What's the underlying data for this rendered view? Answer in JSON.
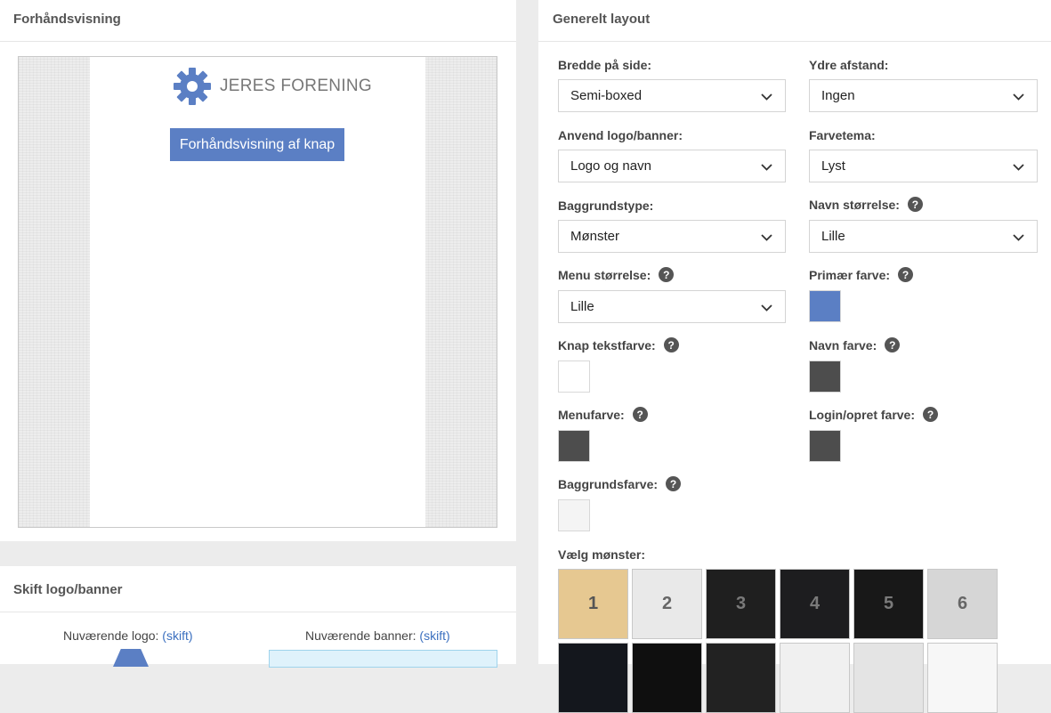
{
  "preview": {
    "title": "Forhåndsvisning",
    "org_name": "JERES FORENING",
    "button_label": "Forhåndsvisning af knap"
  },
  "change_logo": {
    "title": "Skift logo/banner",
    "current_logo_label": "Nuværende logo:",
    "current_banner_label": "Nuværende banner:",
    "change_link": "(skift)"
  },
  "layout": {
    "title": "Generelt layout",
    "page_width": {
      "label": "Bredde på side:",
      "value": "Semi-boxed"
    },
    "outer_spacing": {
      "label": "Ydre afstand:",
      "value": "Ingen"
    },
    "use_logo": {
      "label": "Anvend logo/banner:",
      "value": "Logo og navn"
    },
    "color_theme": {
      "label": "Farvetema:",
      "value": "Lyst"
    },
    "background_type": {
      "label": "Baggrundstype:",
      "value": "Mønster"
    },
    "name_size": {
      "label": "Navn størrelse:",
      "value": "Lille"
    },
    "menu_size": {
      "label": "Menu størrelse:",
      "value": "Lille"
    },
    "primary_color": {
      "label": "Primær farve:",
      "color": "#5b7fc4"
    },
    "button_text_color": {
      "label": "Knap tekstfarve:",
      "color": "#ffffff"
    },
    "name_color": {
      "label": "Navn farve:",
      "color": "#4d4d4d"
    },
    "menu_color": {
      "label": "Menufarve:",
      "color": "#4d4d4d"
    },
    "login_color": {
      "label": "Login/opret farve:",
      "color": "#4d4d4d"
    },
    "background_color": {
      "label": "Baggrundsfarve:",
      "color": "#f4f4f4"
    },
    "help_glyph": "?",
    "pattern_label": "Vælg mønster:",
    "patterns": [
      {
        "label": "1",
        "bg": "#e6c891",
        "fg": "#555555"
      },
      {
        "label": "2",
        "bg": "#e9e9e9",
        "fg": "#666666"
      },
      {
        "label": "3",
        "bg": "#1f1f1f",
        "fg": "#7a7a7a"
      },
      {
        "label": "4",
        "bg": "#1d1d1f",
        "fg": "#7a7a7a"
      },
      {
        "label": "5",
        "bg": "#181818",
        "fg": "#7a7a7a"
      },
      {
        "label": "6",
        "bg": "#d6d6d6",
        "fg": "#666666"
      },
      {
        "label": "",
        "bg": "#14171d",
        "fg": "#7a7a7a"
      },
      {
        "label": "",
        "bg": "#0f0f0f",
        "fg": "#7a7a7a"
      },
      {
        "label": "",
        "bg": "#222222",
        "fg": "#7a7a7a"
      },
      {
        "label": "",
        "bg": "#f0f0f0",
        "fg": "#777777"
      },
      {
        "label": "",
        "bg": "#e4e4e4",
        "fg": "#777777"
      },
      {
        "label": "",
        "bg": "#f7f7f7",
        "fg": "#777777"
      }
    ]
  }
}
